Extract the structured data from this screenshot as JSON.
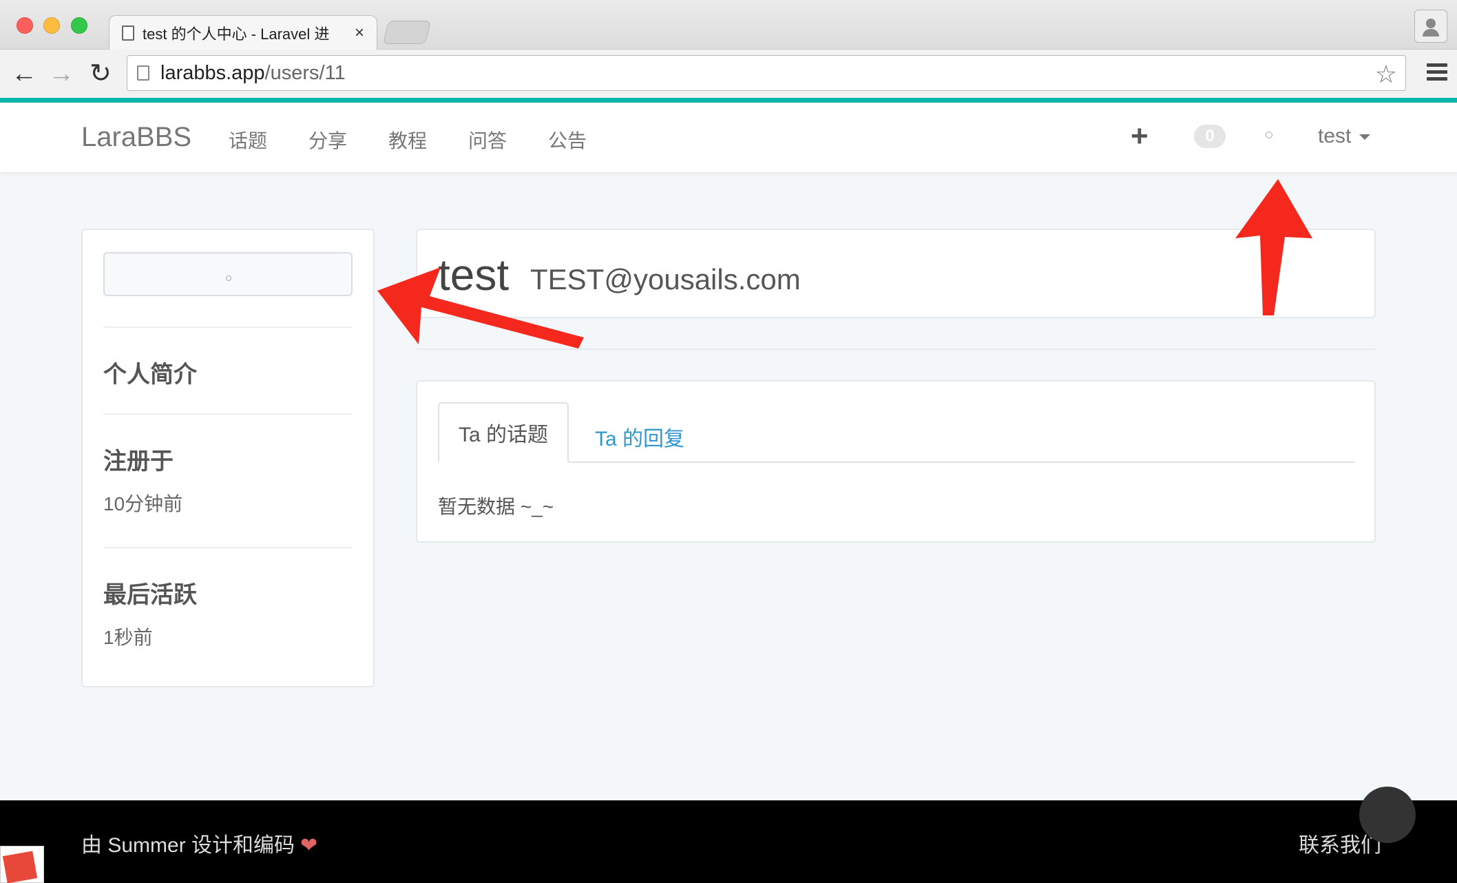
{
  "browser": {
    "tab_title": "test 的个人中心 - Laravel 进",
    "tab_close": "×",
    "url_host": "larabbs.app",
    "url_path": "/users/11",
    "back_glyph": "←",
    "forward_glyph": "→",
    "reload_glyph": "↻",
    "star_glyph": "☆"
  },
  "navbar": {
    "brand": "LaraBBS",
    "links": [
      "话题",
      "分享",
      "教程",
      "问答",
      "公告"
    ],
    "plus": "+",
    "notification_count": "0",
    "user": "test"
  },
  "sidebar": {
    "sections": [
      {
        "title": "个人简介",
        "value": ""
      },
      {
        "title": "注册于",
        "value": "10分钟前"
      },
      {
        "title": "最后活跃",
        "value": "1秒前"
      }
    ]
  },
  "profile": {
    "name": "test",
    "email": "TEST@yousails.com"
  },
  "tabs": {
    "items": [
      "Ta 的话题",
      "Ta 的回复"
    ],
    "active_index": 0,
    "empty_message": "暂无数据 ~_~"
  },
  "footer": {
    "left": "由 Summer 设计和编码",
    "heart": "❤",
    "right": "联系我们"
  },
  "colors": {
    "accent": "#00b5ad",
    "link": "#3097d1",
    "annotation_arrow": "#f5281e"
  }
}
